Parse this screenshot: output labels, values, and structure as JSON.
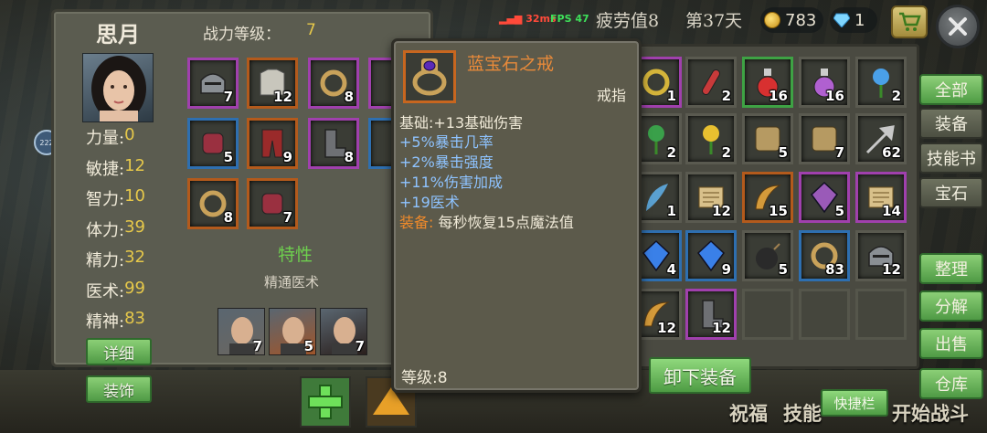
{
  "status": {
    "ping": "32ms",
    "fps": "FPS 47",
    "fatigue": "疲劳值8",
    "day": "第37天",
    "coins": "783",
    "gems": "1"
  },
  "character": {
    "name": "思月",
    "power_label": "战力等级：",
    "power_value": "7",
    "stats": [
      {
        "label": "力量:",
        "value": "0"
      },
      {
        "label": "敏捷:",
        "value": "12"
      },
      {
        "label": "智力:",
        "value": "10"
      },
      {
        "label": "体力:",
        "value": "39"
      },
      {
        "label": "精力:",
        "value": "32"
      },
      {
        "label": "医术:",
        "value": "99"
      },
      {
        "label": "精神:",
        "value": "83"
      }
    ],
    "detail_button": "详细",
    "decor_button": "装饰",
    "trait_title": "特性",
    "trait_name": "精通医术",
    "equipment": [
      {
        "name": "helmet-icon",
        "count": "7",
        "rarity": "purple"
      },
      {
        "name": "chest-armor-icon",
        "count": "12",
        "rarity": "orange"
      },
      {
        "name": "amulet-icon",
        "count": "8",
        "rarity": "purple"
      },
      {
        "name": "bracer-icon",
        "count": "5",
        "rarity": "blue"
      },
      {
        "name": "pants-icon",
        "count": "9",
        "rarity": "orange"
      },
      {
        "name": "boots-icon",
        "count": "8",
        "rarity": "purple"
      },
      {
        "name": "ring-icon",
        "count": "8",
        "rarity": "orange"
      },
      {
        "name": "gloves-icon",
        "count": "7",
        "rarity": "orange"
      }
    ],
    "companions": [
      {
        "name": "old-sage-portrait",
        "count": "7"
      },
      {
        "name": "red-hair-portrait",
        "count": "5"
      },
      {
        "name": "woman-portrait",
        "count": "7"
      }
    ]
  },
  "tooltip": {
    "item_name": "蓝宝石之戒",
    "item_type": "戒指",
    "base": "基础:+13基础伤害",
    "bonuses": [
      "+5%暴击几率",
      "+2%暴击强度",
      "+11%伤害加成",
      "+19医术"
    ],
    "equip_label": "装备:",
    "equip_text": "每秒恢复15点魔法值",
    "level": "等级:8"
  },
  "inventory": {
    "items": [
      {
        "name": "coil-icon",
        "count": "1",
        "rarity": "purple"
      },
      {
        "name": "red-vial-icon",
        "count": "2",
        "rarity": "gray"
      },
      {
        "name": "red-potion-icon",
        "count": "16",
        "rarity": "green"
      },
      {
        "name": "purple-potion-icon",
        "count": "16",
        "rarity": "gray"
      },
      {
        "name": "blue-flower-icon",
        "count": "2",
        "rarity": "gray"
      },
      {
        "name": "green-herb-icon",
        "count": "2",
        "rarity": "gray"
      },
      {
        "name": "yellow-flower-icon",
        "count": "2",
        "rarity": "gray"
      },
      {
        "name": "bark-icon",
        "count": "5",
        "rarity": "gray"
      },
      {
        "name": "leather-icon",
        "count": "7",
        "rarity": "gray"
      },
      {
        "name": "arrowhead-icon",
        "count": "62",
        "rarity": "gray"
      },
      {
        "name": "feather-icon",
        "count": "1",
        "rarity": "gray"
      },
      {
        "name": "scroll-icon",
        "count": "12",
        "rarity": "gray"
      },
      {
        "name": "horn-icon",
        "count": "15",
        "rarity": "orange"
      },
      {
        "name": "crystal-cluster-icon",
        "count": "5",
        "rarity": "purple"
      },
      {
        "name": "spell-scroll-icon",
        "count": "14",
        "rarity": "purple"
      },
      {
        "name": "blue-shard-icon",
        "count": "4",
        "rarity": "blue"
      },
      {
        "name": "blue-gem-icon",
        "count": "9",
        "rarity": "blue"
      },
      {
        "name": "bomb-icon",
        "count": "5",
        "rarity": "gray"
      },
      {
        "name": "bracelet-icon",
        "count": "83",
        "rarity": "blue"
      },
      {
        "name": "iron-helm-icon",
        "count": "12",
        "rarity": "gray"
      },
      {
        "name": "tail-icon",
        "count": "12",
        "rarity": "gray"
      },
      {
        "name": "iron-boots-icon",
        "count": "12",
        "rarity": "purple"
      }
    ]
  },
  "tabs": {
    "all": "全部",
    "equipment": "装备",
    "skill_books": "技能书",
    "gems": "宝石",
    "sort": "整理",
    "dismantle": "分解",
    "sell": "出售",
    "storage": "仓库"
  },
  "actions": {
    "unequip": "卸下装备",
    "quickbar": "快捷栏"
  },
  "bottom": {
    "blessing": "祝福",
    "skill": "技能",
    "start_battle": "开始战斗"
  },
  "side_badge": "222",
  "colors": {
    "rarity_purple": "#a040ad",
    "rarity_orange": "#b35a1c",
    "rarity_blue": "#2e6fb0",
    "rarity_green": "#3ea244",
    "stat_value": "#e6c84a",
    "bonus_text": "#8ec3ff",
    "item_name": "#e88a3a"
  }
}
